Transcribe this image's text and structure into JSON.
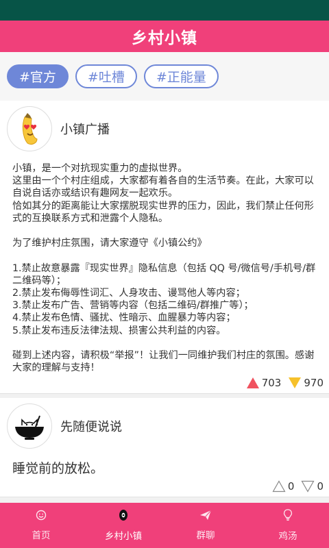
{
  "app": {
    "title": "乡村小镇"
  },
  "tags": [
    "#官方",
    "#吐槽",
    "#正能量"
  ],
  "posts": [
    {
      "author": "小镇广播",
      "avatar_icon": "banana-heart-eyes-icon",
      "paragraphs": [
        "小镇，是一个对抗现实重力的虚拟世界。",
        "这里由一个个村庄组成，大家都有着各自的生活节奏。在此，大家可以自说自话亦或结识有趣网友一起欢乐。",
        "恰如其分的距离能让大家摆脱现实世界的压力，因此，我们禁止任何形式的互换联系方式和泄露个人隐私。",
        "",
        "为了维护村庄氛围，请大家遵守《小镇公约》",
        "",
        "1.禁止故意暴露『现实世界』隐私信息（包括 QQ 号/微信号/手机号/群二维码等）；",
        "2.禁止发布侮辱性词汇、人身攻击、谩骂他人等内容；",
        "3.禁止发布广告、营销等内容（包括二维码/群推广等）；",
        "4.禁止发布色情、骚扰、性暗示、血腥暴力等内容；",
        "5.禁止发布违反法律法规、损害公共利益的内容。",
        "",
        "碰到上述内容，请积极“举报”！让我们一同维护我们村庄的氛围。感谢大家的理解与支持！"
      ],
      "upvotes": "703",
      "downvotes": "970"
    },
    {
      "author": "先随便说说",
      "avatar_icon": "cat-in-bowl-icon",
      "text": "睡觉前的放松。",
      "upvotes": "0",
      "downvotes": "0"
    }
  ],
  "tabs": [
    {
      "label": "首页",
      "icon": "smile-icon"
    },
    {
      "label": "乡村小镇",
      "icon": "village-eye-icon"
    },
    {
      "label": "群聊",
      "icon": "paper-plane-icon"
    },
    {
      "label": "鸡汤",
      "icon": "lightbulb-icon"
    }
  ],
  "colors": {
    "status_bar": "#075447",
    "brand": "#f0407a",
    "tag": "#6e87d8",
    "up": "#f0525f",
    "down": "#f6c12b"
  }
}
